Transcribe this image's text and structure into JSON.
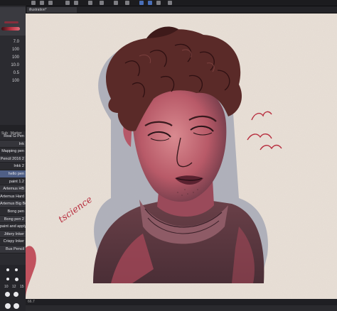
{
  "document": {
    "tab_label": "illustration*"
  },
  "tool_properties": {
    "rows": [
      {
        "value": "7.0"
      },
      {
        "value": "100"
      },
      {
        "value": "100"
      },
      {
        "value": "10.0"
      },
      {
        "value": "0.5"
      },
      {
        "value": "100"
      }
    ]
  },
  "subtool_tabs": [
    "Sub",
    "Marker"
  ],
  "brushes": [
    {
      "label": "Real G-Pen",
      "selected": false
    },
    {
      "label": "Ink",
      "selected": false
    },
    {
      "label": "Mapping pen",
      "selected": false
    },
    {
      "label": "Pencil 2016 2",
      "selected": false
    },
    {
      "label": "Inkk 2",
      "selected": false
    },
    {
      "label": "hello pen",
      "selected": true
    },
    {
      "label": "paint 1.2",
      "selected": false
    },
    {
      "label": "Artemus HB",
      "selected": false
    },
    {
      "label": "Artemus Hard",
      "selected": false
    },
    {
      "label": "Artemus Big Boy",
      "selected": false
    },
    {
      "label": "Bong pen",
      "selected": false
    },
    {
      "label": "Bong pen 2",
      "selected": false
    },
    {
      "label": "paint and apply",
      "selected": false
    },
    {
      "label": "Jittery Inker",
      "selected": false
    },
    {
      "label": "Crispy Inker",
      "selected": false
    },
    {
      "label": "Bus Pencil",
      "selected": false
    }
  ],
  "brush_sizes": [
    {
      "label": "10"
    },
    {
      "label": "12"
    },
    {
      "label": "15"
    }
  ],
  "artwork": {
    "signature": "tscience",
    "colors": {
      "paper": "#e8dfd6",
      "skin": "#c87080",
      "hair": "#5a2a28",
      "shadow": "#4a3a40",
      "accent": "#b83040"
    }
  },
  "status": {
    "zoom": "66.7"
  }
}
